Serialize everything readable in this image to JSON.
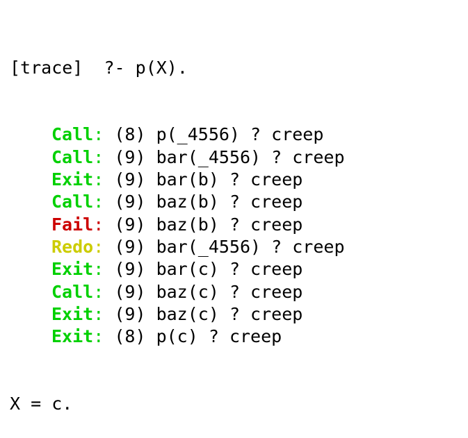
{
  "prompt": {
    "tag": "[trace]",
    "symbol": "?-",
    "query": "p(X)."
  },
  "trace": [
    {
      "port": "Call",
      "depth": "(8)",
      "goal": "p(_4556)",
      "action": "? creep",
      "kind": "call"
    },
    {
      "port": "Call",
      "depth": "(9)",
      "goal": "bar(_4556)",
      "action": "? creep",
      "kind": "call"
    },
    {
      "port": "Exit",
      "depth": "(9)",
      "goal": "bar(b)",
      "action": "? creep",
      "kind": "exit"
    },
    {
      "port": "Call",
      "depth": "(9)",
      "goal": "baz(b)",
      "action": "? creep",
      "kind": "call"
    },
    {
      "port": "Fail",
      "depth": "(9)",
      "goal": "baz(b)",
      "action": "? creep",
      "kind": "fail"
    },
    {
      "port": "Redo",
      "depth": "(9)",
      "goal": "bar(_4556)",
      "action": "? creep",
      "kind": "redo"
    },
    {
      "port": "Exit",
      "depth": "(9)",
      "goal": "bar(c)",
      "action": "? creep",
      "kind": "exit"
    },
    {
      "port": "Call",
      "depth": "(9)",
      "goal": "baz(c)",
      "action": "? creep",
      "kind": "call"
    },
    {
      "port": "Exit",
      "depth": "(9)",
      "goal": "baz(c)",
      "action": "? creep",
      "kind": "exit"
    },
    {
      "port": "Exit",
      "depth": "(8)",
      "goal": "p(c)",
      "action": "? creep",
      "kind": "exit"
    }
  ],
  "result": "X = c.",
  "colors": {
    "call_exit": "#00d000",
    "fail": "#cc0000",
    "redo": "#cccc00",
    "text": "#000000",
    "background": "#ffffff"
  }
}
